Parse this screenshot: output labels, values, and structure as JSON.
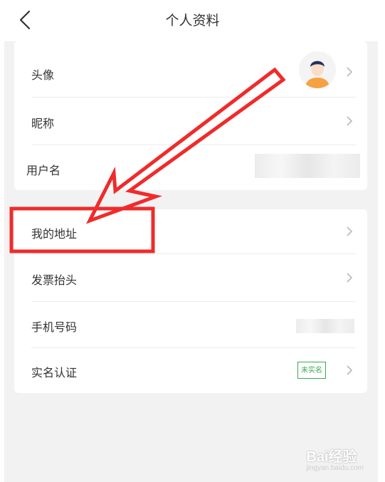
{
  "header": {
    "title": "个人资料"
  },
  "section1": {
    "items": [
      {
        "label": "头像"
      },
      {
        "label": "昵称"
      },
      {
        "label": "用户名"
      }
    ]
  },
  "section2": {
    "items": [
      {
        "label": "我的地址"
      },
      {
        "label": "发票抬头"
      },
      {
        "label": "手机号码"
      },
      {
        "label": "实名认证"
      }
    ],
    "verify_badge": "未实名"
  },
  "watermark": {
    "logo": "Bai经验",
    "url": "jingyan.baidu.com"
  },
  "colors": {
    "annotation_red": "#ef2b2b",
    "badge_green": "#3aa856",
    "avatar_shirt": "#f5a243"
  },
  "icons": {
    "back": "chevron-left-icon",
    "row_arrow": "chevron-right-icon"
  }
}
